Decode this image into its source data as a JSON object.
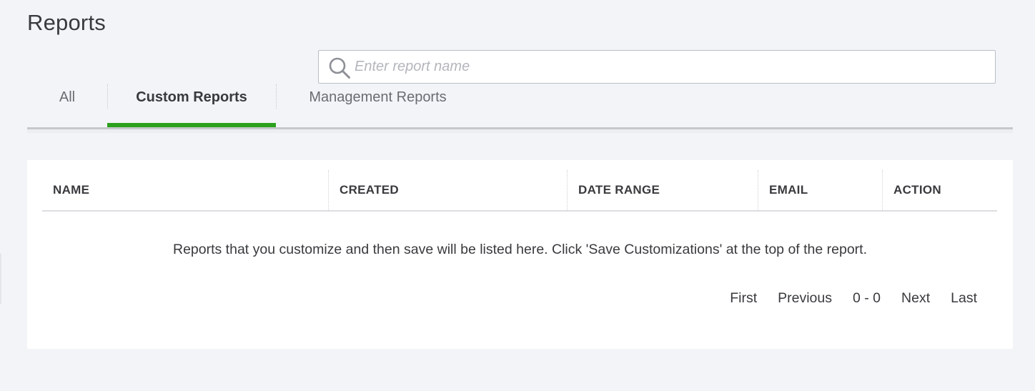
{
  "page": {
    "title": "Reports"
  },
  "search": {
    "placeholder": "Enter report name",
    "value": ""
  },
  "tabs": [
    {
      "label": "All",
      "active": false
    },
    {
      "label": "Custom Reports",
      "active": true
    },
    {
      "label": "Management Reports",
      "active": false
    }
  ],
  "table": {
    "columns": [
      "NAME",
      "CREATED",
      "DATE RANGE",
      "EMAIL",
      "ACTION"
    ],
    "rows": [],
    "empty_message": "Reports that you customize and then save will be listed here. Click 'Save Customizations' at the top of the report."
  },
  "pagination": {
    "first": "First",
    "previous": "Previous",
    "range": "0 - 0",
    "next": "Next",
    "last": "Last"
  },
  "colors": {
    "active_tab_indicator": "#2ca01c",
    "background": "#f3f4f8",
    "text": "#393a3d"
  },
  "icons": {
    "search": "search-icon"
  }
}
